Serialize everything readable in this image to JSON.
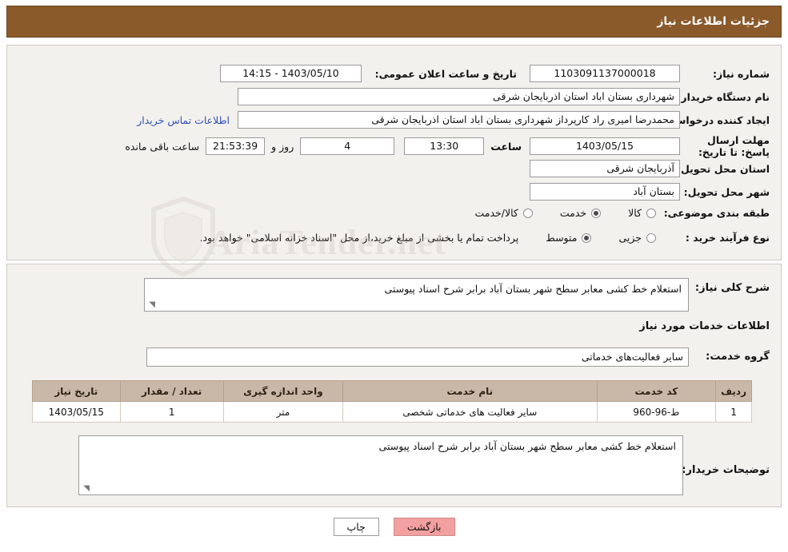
{
  "header": {
    "title": "جزئیات اطلاعات نیاز"
  },
  "form": {
    "need_number_label": "شماره نیاز:",
    "need_number_value": "1103091137000018",
    "public_announce_label": "تاریخ و ساعت اعلان عمومی:",
    "public_announce_value": "1403/05/10 - 14:15",
    "buyer_org_label": "نام دستگاه خریدار:",
    "buyer_org_value": "شهرداری بستان اباد استان اذربایجان شرقی",
    "requester_label": "ایجاد کننده درخواست:",
    "requester_value": "محمدرضا امیری راد کارپرداز شهرداری بستان اباد استان اذربایجان شرقی",
    "contact_link": "اطلاعات تماس خریدار",
    "deadline_label": "مهلت ارسال پاسخ: تا تاریخ:",
    "deadline_date": "1403/05/15",
    "hour_label": "ساعت",
    "deadline_time": "13:30",
    "days_value": "4",
    "days_unit_label": "روز و",
    "countdown_value": "21:53:39",
    "remaining_label": "ساعت باقی مانده",
    "province_label": "استان محل تحویل:",
    "province_value": "آذربایجان شرقی",
    "city_label": "شهر محل تحویل:",
    "city_value": "بستان آباد",
    "category_label": "طبقه بندی موضوعی:",
    "category_options": [
      {
        "label": "کالا",
        "selected": false
      },
      {
        "label": "خدمت",
        "selected": true
      },
      {
        "label": "کالا/خدمت",
        "selected": false
      }
    ],
    "process_label": "نوع فرآیند خرید :",
    "process_options": [
      {
        "label": "جزیی",
        "selected": false
      },
      {
        "label": "متوسط",
        "selected": true
      }
    ],
    "process_note": "پرداخت تمام یا بخشی از مبلغ خرید،از محل \"اسناد خزانه اسلامی\" خواهد بود."
  },
  "details": {
    "general_desc_label": "شرح کلی نیاز:",
    "general_desc_value": "استعلام خط کشی معابر سطح شهر بستان آباد برابر شرح اسناد پیوستی",
    "services_info_title": "اطلاعات خدمات مورد نیاز",
    "service_group_label": "گروه خدمت:",
    "service_group_value": "سایر فعالیت‌های خدماتی",
    "table": {
      "columns": [
        "ردیف",
        "کد خدمت",
        "نام خدمت",
        "واحد اندازه گیری",
        "تعداد / مقدار",
        "تاریخ نیاز"
      ],
      "rows": [
        {
          "row": "1",
          "service_code": "ط-96-960",
          "service_name": "سایر فعالیت های خدماتی شخصی",
          "unit": "متر",
          "quantity": "1",
          "need_date": "1403/05/15"
        }
      ]
    },
    "buyer_notes_label": "توضیحات خریدار:",
    "buyer_notes_value": "استعلام خط کشی معابر سطح شهر بستان آباد برابر شرح اسناد پیوستی"
  },
  "footer": {
    "print_button": "چاپ",
    "back_button": "بازگشت"
  },
  "watermark": {
    "text": "AriaTender.net",
    "icon": "shield-icon"
  }
}
